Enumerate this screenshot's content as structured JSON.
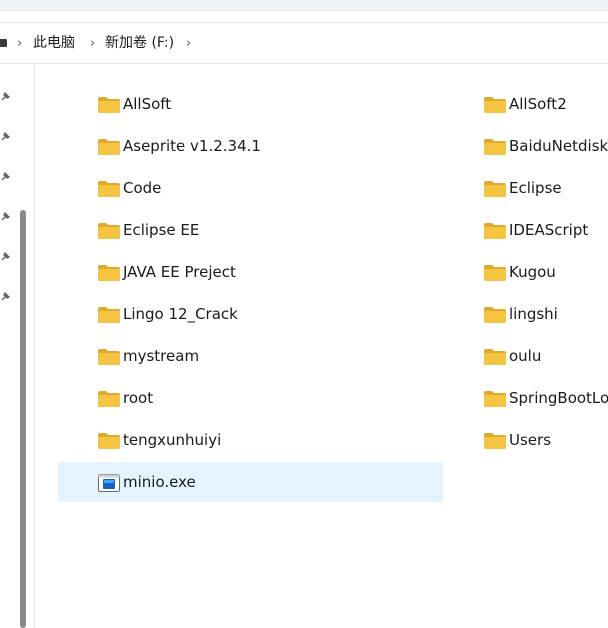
{
  "breadcrumb": {
    "items": [
      "此电脑",
      "新加卷 (F:)"
    ]
  },
  "colors": {
    "selection": "#e5f3ff",
    "folder": "#f6c443",
    "folder_dark": "#e0a92c"
  },
  "files": {
    "left_column": [
      "AllSoft",
      "Aseprite v1.2.34.1",
      "Code",
      "Eclipse EE",
      "JAVA EE Preject",
      "Lingo 12_Crack",
      "mystream",
      "root",
      "tengxunhuiyi",
      "minio.exe"
    ],
    "right_column": [
      "AllSoft2",
      "BaiduNetdiskI",
      "Eclipse",
      "IDEAScript",
      "Kugou",
      "lingshi",
      "oulu",
      "SpringBootLo",
      "Users"
    ],
    "selected": "minio.exe",
    "exe_icon": "executable-icon",
    "folder_icon": "folder-icon"
  }
}
